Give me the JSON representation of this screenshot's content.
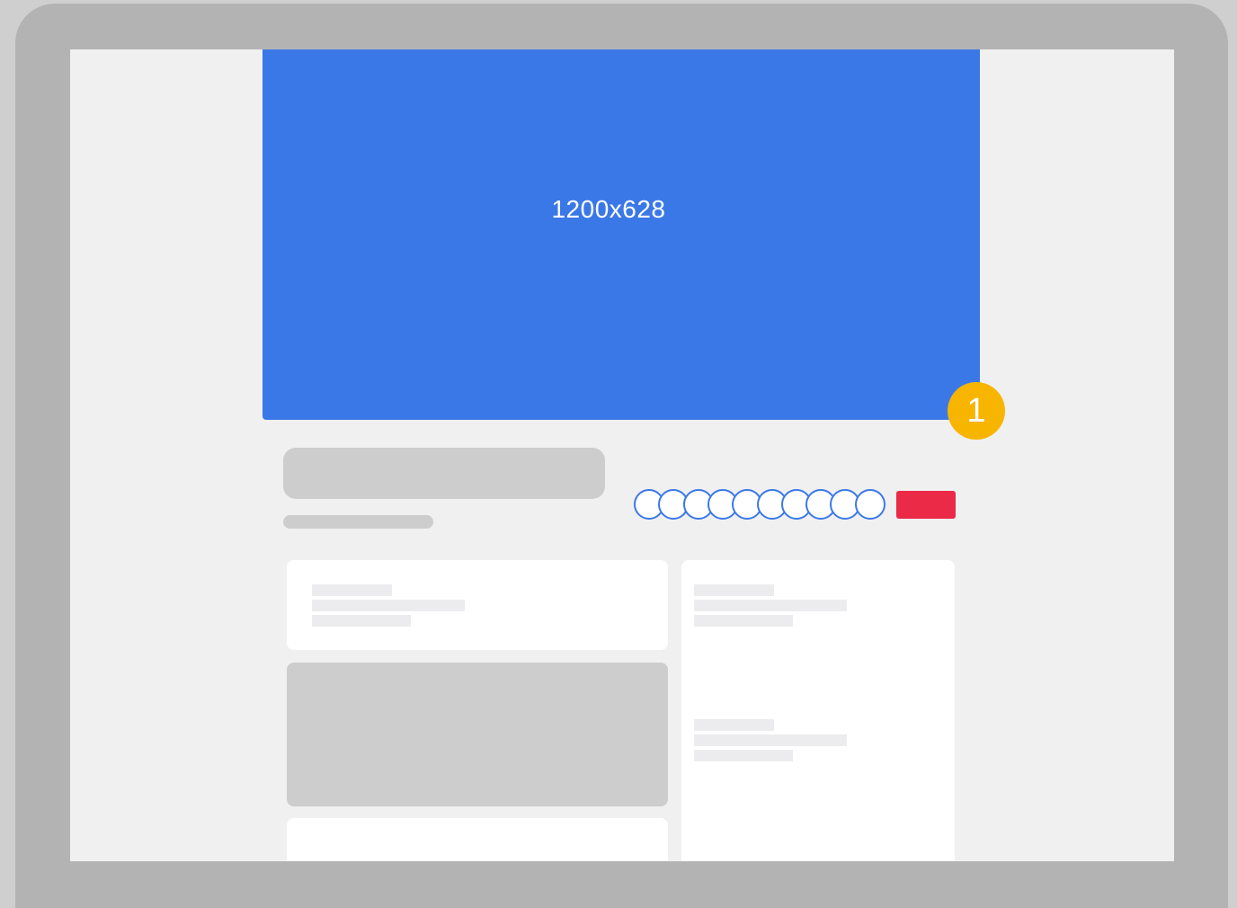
{
  "cover": {
    "label": "1200x628",
    "color": "#3b78e7"
  },
  "callout": {
    "number": "1",
    "color": "#f7b500"
  },
  "friends": {
    "count": 10,
    "color": "#3b78e7"
  },
  "action_button": {
    "color": "#ea2a47"
  }
}
